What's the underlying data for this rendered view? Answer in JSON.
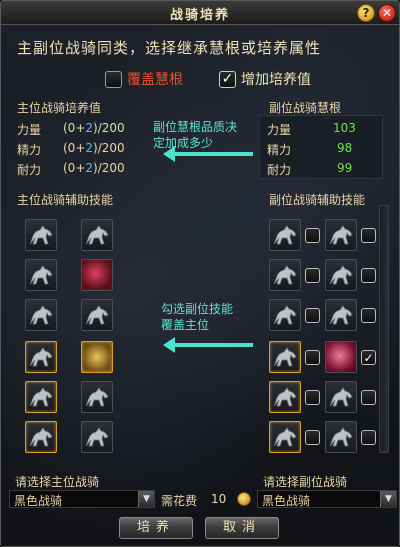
{
  "window": {
    "title": "战骑培养"
  },
  "header": {
    "instruction": "主副位战骑同类，选择继承慧根或培养属性"
  },
  "options": {
    "cover_label": "覆盖慧根",
    "cover_checked": false,
    "add_label": "增加培养值",
    "add_checked": true
  },
  "main_stats": {
    "title": "主位战骑培养值",
    "rows": [
      {
        "name": "力量",
        "base": "(0+",
        "plus": "2",
        "tail": ")/200"
      },
      {
        "name": "精力",
        "base": "(0+",
        "plus": "2",
        "tail": ")/200"
      },
      {
        "name": "耐力",
        "base": "(0+",
        "plus": "2",
        "tail": ")/200"
      }
    ]
  },
  "sub_stats": {
    "title": "副位战骑慧根",
    "rows": [
      {
        "name": "力量",
        "value": "103"
      },
      {
        "name": "精力",
        "value": "98"
      },
      {
        "name": "耐力",
        "value": "99"
      }
    ]
  },
  "notes": {
    "note1_line1": "副位慧根品质决",
    "note1_line2": "定加成多少",
    "note2_line1": "勾选副位技能",
    "note2_line2": "覆盖主位"
  },
  "skills": {
    "main_title": "主位战骑辅助技能",
    "sub_title": "副位战骑辅助技能"
  },
  "footer": {
    "main_select_label": "请选择主位战骑",
    "main_select_value": "黑色战骑",
    "sub_select_label": "请选择副位战骑",
    "sub_select_value": "黑色战骑",
    "cost_label": "需花费",
    "cost_value": "10",
    "train_button": "培养",
    "cancel_button": "取消"
  },
  "colors": {
    "plus_blue": "#5ab4ff",
    "value_green": "#6ee14d",
    "note_cyan": "#5ee6d4",
    "cover_red": "#e4532f"
  },
  "icons": {
    "help": "help-icon",
    "close": "close-icon",
    "horse": "horse-skill-icon",
    "coin": "coin-icon",
    "dropdown": "chevron-down-icon"
  }
}
